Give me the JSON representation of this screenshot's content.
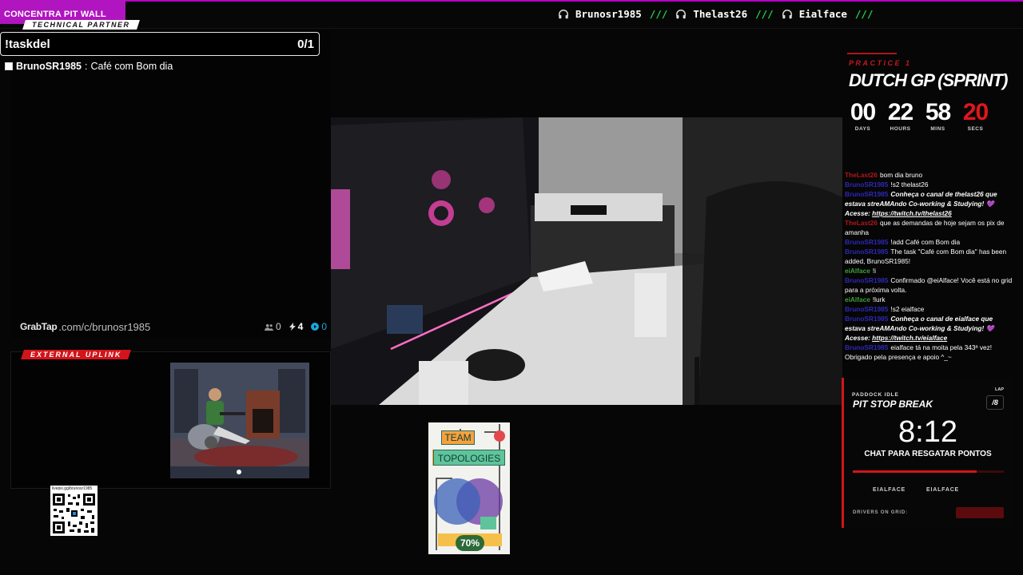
{
  "top_bar": {
    "brand_title": "CONCENTRA PIT WALL",
    "listeners": [
      {
        "name": "Brunosr1985",
        "icon": "headphones-icon",
        "separator": "///"
      },
      {
        "name": "Thelast26",
        "icon": "headphones-icon",
        "separator": "///"
      },
      {
        "name": "Eialface",
        "icon": "headphones-icon",
        "separator": "///"
      }
    ],
    "accent_color": "#b015c0"
  },
  "task_panel": {
    "tag": "TECHNICAL PARTNER",
    "command": "!taskdel",
    "count": "0/1",
    "tasks": [
      {
        "user": "BrunoSR1985",
        "text": "Café com Bom dia",
        "done": false
      }
    ]
  },
  "grabtap": {
    "logo": "GrabTap",
    "url": ".com/c/brunosr1985",
    "stats": [
      {
        "icon": "users-icon",
        "value": "0"
      },
      {
        "icon": "bolt-icon",
        "value": "4"
      },
      {
        "icon": "play-icon",
        "value": "0"
      }
    ]
  },
  "uplink": {
    "tag": "EXTERNAL UPLINK"
  },
  "qr": {
    "url": "livepix.gg/brunosr1985"
  },
  "book": {
    "title_line1": "TEAM",
    "title_line2": "TOPOLOGIES",
    "progress": "70%",
    "progress_fraction": 0.7
  },
  "race": {
    "session": "PRACTICE 1",
    "title": "DUTCH GP (SPRINT)",
    "countdown": [
      {
        "value": "00",
        "label": "DAYS"
      },
      {
        "value": "22",
        "label": "HOURS"
      },
      {
        "value": "58",
        "label": "MINS"
      },
      {
        "value": "20",
        "label": "SECS"
      }
    ],
    "accent_red": "#d1151b"
  },
  "chat": [
    {
      "user": "TheLast26",
      "user_color": "red",
      "text": "bom dia bruno",
      "style": "normal"
    },
    {
      "user": "BrunoSR1985",
      "user_color": "blue",
      "text": "!s2 thelast26",
      "style": "normal"
    },
    {
      "user": "BrunoSR1985",
      "user_color": "blue",
      "text": "Conheça o canal de thelast26 que estava streAMAndo Co-working & Studying! 💜 Acesse:",
      "link": "https://twitch.tv/thelast26",
      "style": "italic"
    },
    {
      "user": "TheLast26",
      "user_color": "red",
      "text": "que as demandas de hoje sejam os pix de amanha",
      "style": "normal"
    },
    {
      "user": "BrunoSR1985",
      "user_color": "blue",
      "text": "!add Café com Bom dia",
      "style": "normal"
    },
    {
      "user": "BrunoSR1985",
      "user_color": "blue",
      "text": "The task \"Café com Bom dia\" has been added, BrunoSR1985!",
      "style": "normal"
    },
    {
      "user": "eiAlface",
      "user_color": "green",
      "text": "!i",
      "style": "normal"
    },
    {
      "user": "BrunoSR1985",
      "user_color": "blue",
      "text": "Confirmado @eiAlface! Você está no grid para a próxima volta.",
      "style": "normal"
    },
    {
      "user": "eiAlface",
      "user_color": "green",
      "text": "!lurk",
      "style": "normal"
    },
    {
      "user": "BrunoSR1985",
      "user_color": "blue",
      "text": "!s2 eialface",
      "style": "normal"
    },
    {
      "user": "BrunoSR1985",
      "user_color": "blue",
      "text": "Conheça o canal de eialface que estava streAMAndo Co-working & Studying! 💜 Acesse:",
      "link": "https://twitch.tv/eialface",
      "style": "italic"
    },
    {
      "user": "BrunoSR1985",
      "user_color": "blue",
      "text": "eialface tá na moita pela 343ª vez! Obrigado pela presença e apoio ^_~",
      "style": "normal"
    }
  ],
  "pit": {
    "label": "PADDOCK IDLE",
    "title": "PIT STOP BREAK",
    "lap_label": "LAP",
    "lap_value": "/8",
    "timer": "8:12",
    "subtitle": "CHAT PARA RESGATAR PONTOS",
    "progress_fraction": 0.82,
    "driver_a": "EIALFACE",
    "driver_b": "EIALFACE",
    "grid_label": "DRIVERS ON GRID:"
  }
}
